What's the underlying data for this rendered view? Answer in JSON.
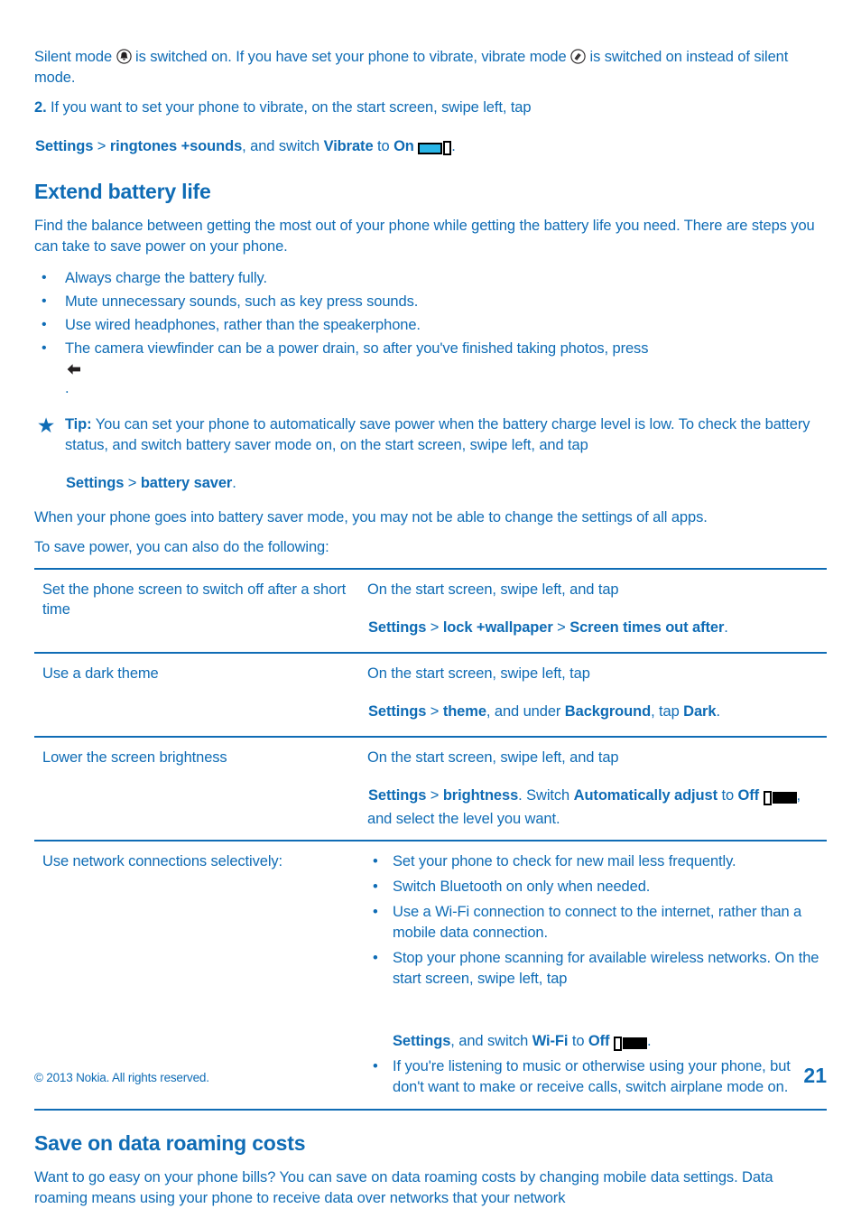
{
  "document": {
    "page_number": "21",
    "copyright": "© 2013 Nokia. All rights reserved.",
    "text_color": "#0f6cb5",
    "accent_color": "#29b6e8"
  },
  "intro": {
    "line1_a": "Silent mode ",
    "line1_b": " is switched on. If you have set your phone to vibrate, vibrate mode ",
    "line1_c": " is switched on instead of silent mode.",
    "step_number": "2.",
    "step_a": " If you want to set your phone to vibrate, on the start screen, swipe left, tap ",
    "step_settings": "Settings",
    "step_gt1": " > ",
    "step_ringtones": "ringtones +sounds",
    "step_b": ", and switch ",
    "step_vibrate": "Vibrate",
    "step_c": " to ",
    "step_on": "On",
    "step_d": "."
  },
  "section_battery": {
    "heading": "Extend battery life",
    "intro": "Find the balance between getting the most out of your phone while getting the battery life you need. There are steps you can take to save power on your phone.",
    "bullets": [
      {
        "text": "Always charge the battery fully.",
        "icon": null
      },
      {
        "text": "Mute unnecessary sounds, such as key press sounds.",
        "icon": null
      },
      {
        "text": "Use wired headphones, rather than the speakerphone.",
        "icon": null
      },
      {
        "text": "The camera viewfinder can be a power drain, so after you've finished taking photos, press ",
        "icon": "back-arrow-icon",
        "text_after": "."
      }
    ],
    "tip": {
      "icon": "star-icon",
      "label": "Tip:",
      "body_a": " You can set your phone to automatically save power when the battery charge level is low. To check the battery status, and switch battery saver mode on, on the start screen, swipe left, and tap ",
      "settings": "Settings",
      "gt": " > ",
      "battery_saver": "battery saver",
      "body_b": "."
    },
    "after_tip": "When your phone goes into battery saver mode, you may not be able to change the settings of all apps.",
    "table_intro": "To save power, you can also do the following:"
  },
  "table": {
    "rows": [
      {
        "label": "Set the phone screen to switch off after a short time",
        "value": {
          "a": "On the start screen, swipe left, and tap ",
          "settings": "Settings",
          "gt1": " > ",
          "b1": "lock +wallpaper",
          "gt2": " > ",
          "b2": "Screen times out after",
          "end": "."
        }
      },
      {
        "label": "Use a dark theme",
        "value": {
          "a": "On the start screen, swipe left, tap ",
          "settings": "Settings",
          "gt1": " > ",
          "b1": "theme",
          "mid": ", and under ",
          "b2": "Background",
          "mid2": ", tap ",
          "b3": "Dark",
          "end": "."
        }
      },
      {
        "label": "Lower the screen brightness",
        "value": {
          "a": "On the start screen, swipe left, and tap ",
          "settings": "Settings",
          "gt1": " > ",
          "b1": "brightness",
          "mid": ". Switch ",
          "b2": "Automatically adjust",
          "mid2": " to ",
          "b3": "Off",
          "end": ", and select the level you want."
        }
      },
      {
        "label": "Use network connections selectively:",
        "bullets": [
          {
            "text": "Set your phone to check for new mail less frequently."
          },
          {
            "text": "Switch Bluetooth on only when needed."
          },
          {
            "text": "Use a Wi-Fi connection to connect to the internet, rather than a mobile data connection."
          },
          {
            "text_a": "Stop your phone scanning for available wireless networks. On the start screen, swipe left, tap ",
            "settings": "Settings",
            "text_b": ", and switch ",
            "b1": "Wi-Fi",
            "text_c": " to ",
            "b2": "Off",
            "text_d": "."
          },
          {
            "text": "If you're listening to music or otherwise using your phone, but don't want to make or receive calls, switch airplane mode on."
          }
        ]
      }
    ]
  },
  "section_roaming": {
    "heading": "Save on data roaming costs",
    "intro": "Want to go easy on your phone bills? You can save on data roaming costs by changing mobile data settings. Data roaming means using your phone to receive data over networks that your network"
  }
}
